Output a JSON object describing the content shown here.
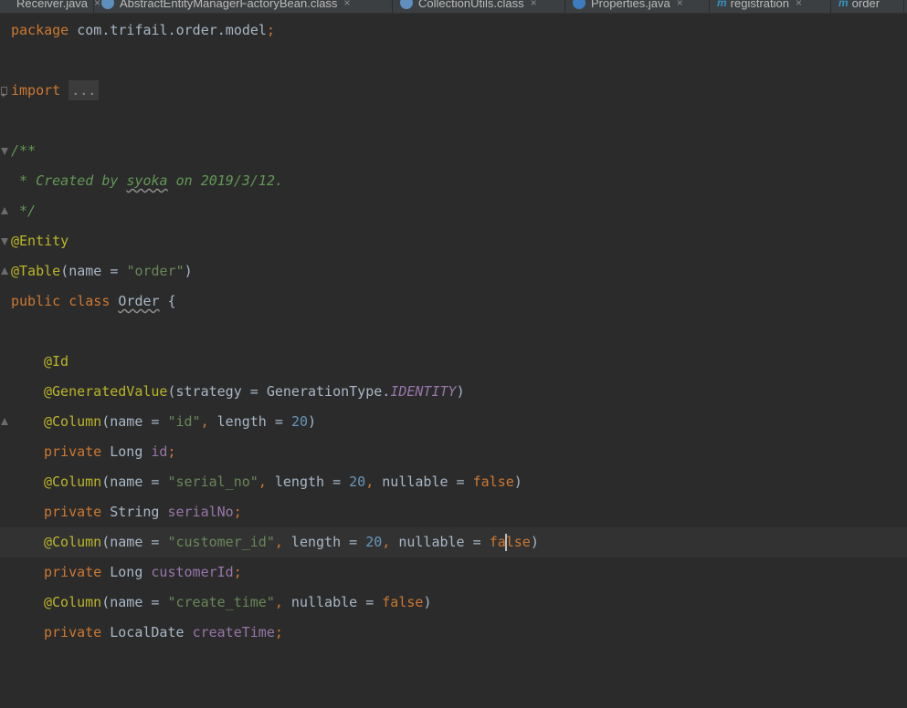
{
  "tabs": [
    {
      "label": "Receiver.java",
      "icon": "java-class-icon"
    },
    {
      "label": "AbstractEntityManagerFactoryBean.class",
      "icon": "compiled-class-icon"
    },
    {
      "label": "CollectionUtils.class",
      "icon": "compiled-class-icon"
    },
    {
      "label": "Properties.java",
      "icon": "java-class-icon"
    },
    {
      "label": "registration",
      "icon": "maven-module-icon"
    },
    {
      "label": "order",
      "icon": "maven-module-icon"
    }
  ],
  "tab_close_glyph": "×",
  "code": {
    "package_kw": "package",
    "package_name": " com.trifail.order.model",
    "semicolon": ";",
    "import_kw": "import",
    "import_fold": "...",
    "doc_open": "/**",
    "doc_created": " * Created by ",
    "doc_author": "syoka",
    "doc_date": " on 2019/3/12.",
    "doc_close": " */",
    "ann_entity": "@Entity",
    "ann_table": "@Table",
    "table_args_open": "(name = ",
    "table_name": "\"order\"",
    "close_paren": ")",
    "public_kw": "public",
    "class_kw": "class",
    "class_name": "Order",
    "open_brace": " {",
    "ann_id": "@Id",
    "ann_generated": "@GeneratedValue",
    "strategy_args": "(strategy = GenerationType.",
    "identity": "IDENTITY",
    "ann_column": "@Column",
    "name_eq": "(name = ",
    "col_id": "\"id\"",
    "col_serial": "\"serial_no\"",
    "col_customer": "\"customer_id\"",
    "col_create": "\"create_time\"",
    "comma": ",",
    "length_eq": " length = ",
    "nullable_eq": " nullable = ",
    "len_20": "20",
    "false_kw": "false",
    "false_kw_a": "fa",
    "false_kw_b": "lse",
    "private_kw": "private",
    "type_long": " Long ",
    "type_string": " String ",
    "type_localdate": " LocalDate ",
    "field_id": "id",
    "field_serial": "serialNo",
    "field_customer": "customerId",
    "field_create": "createTime"
  },
  "colors": {
    "background": "#2b2b2b",
    "keyword": "#cc7832",
    "annotation": "#bbb529",
    "string": "#6a8759",
    "number": "#6897bb",
    "field": "#9876aa",
    "comment": "#629755"
  }
}
